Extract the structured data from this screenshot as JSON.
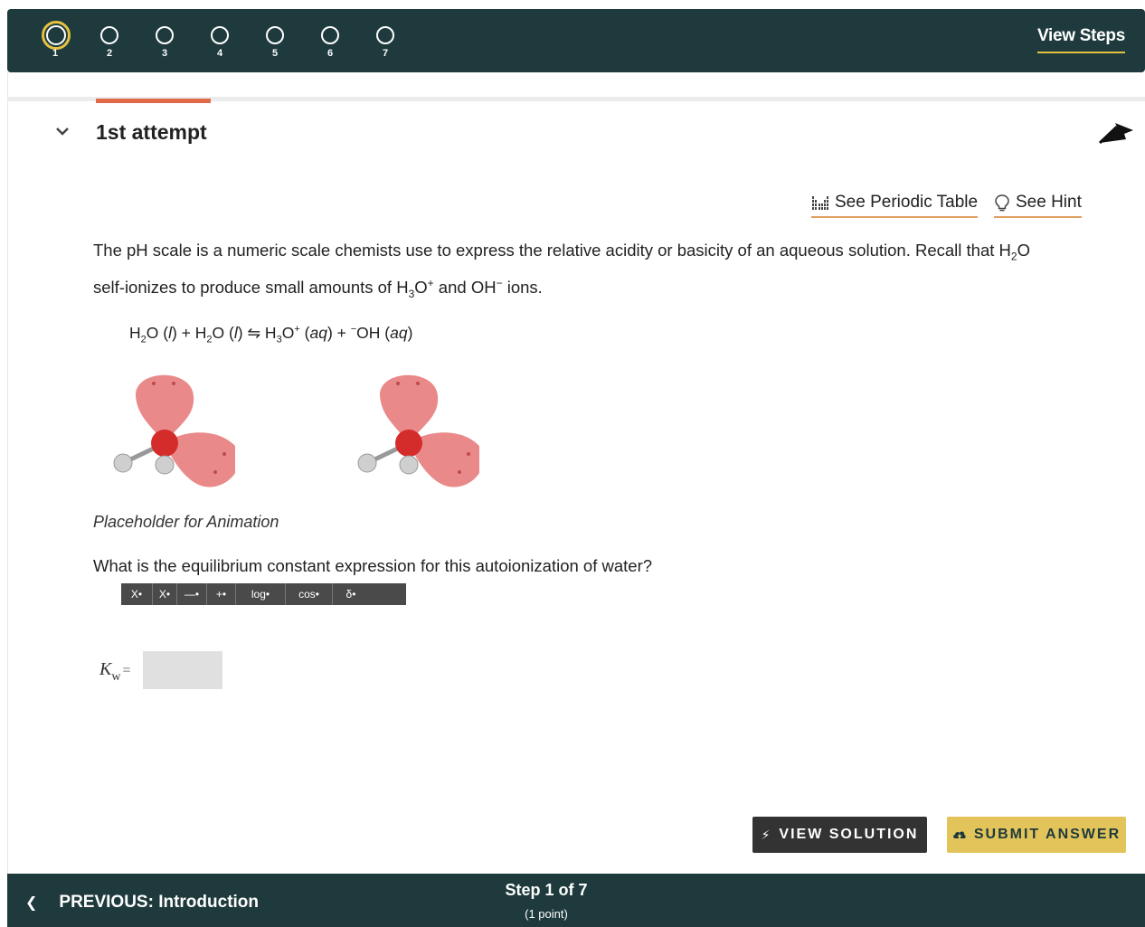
{
  "steps": [
    {
      "num": "1",
      "current": true
    },
    {
      "num": "2"
    },
    {
      "num": "3"
    },
    {
      "num": "4"
    },
    {
      "num": "5"
    },
    {
      "num": "6"
    },
    {
      "num": "7"
    }
  ],
  "header": {
    "view_steps": "View Steps"
  },
  "attempt": {
    "title": "1st attempt"
  },
  "helpers": {
    "periodic_table": "See Periodic Table",
    "hint": "See Hint"
  },
  "question": {
    "intro_a": "The pH scale is a numeric scale chemists use to express the relative acidity or basicity of an aqueous solution.  Recall that H",
    "intro_b": "O",
    "intro_c": "self-ionizes to produce small amounts of H",
    "intro_d": "O",
    "intro_e": " and OH",
    "intro_f": " ions.",
    "sub2": "2",
    "sub3": "3",
    "sup_plus": "+",
    "sup_minus": "−",
    "placeholder": "Placeholder for Animation",
    "prompt": "What is the equilibrium constant expression for this autoionization of water?"
  },
  "equation": {
    "h": "H",
    "o_l1": "O (",
    "l": "l",
    "plus1": ") + H",
    "o_l2": "O (",
    "arrow_h3o": ") ⇋ H",
    "o": "O",
    "plus2": "(",
    "aq": "aq",
    "mid": ") + ",
    "oh": "OH (",
    "end": ")"
  },
  "toolbar": {
    "buttons": [
      "X•",
      "X•",
      "—•",
      "+•",
      "log•",
      "cos•",
      "δ•"
    ]
  },
  "answer": {
    "kw_label": "K",
    "kw_sub": "w",
    "eq": "=",
    "value": ""
  },
  "actions": {
    "view_solution": "VIEW SOLUTION",
    "submit": "SUBMIT ANSWER"
  },
  "footer": {
    "previous": "PREVIOUS: Introduction",
    "step": "Step 1 of 7",
    "points": "(1 point)"
  },
  "colors": {
    "header_bg": "#1e3a3d",
    "accent_yellow": "#e3c23f",
    "tab_accent": "#e06a48",
    "submit_bg": "#e3c45a"
  }
}
